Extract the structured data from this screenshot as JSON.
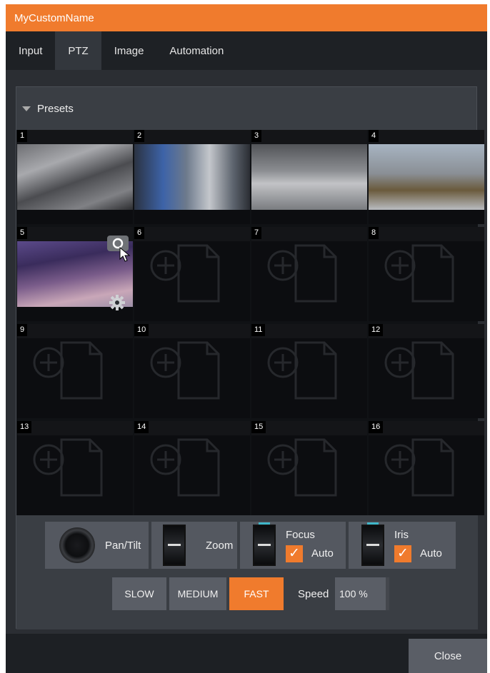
{
  "window": {
    "title": "MyCustomName"
  },
  "tabs": [
    {
      "label": "Input"
    },
    {
      "label": "PTZ"
    },
    {
      "label": "Image"
    },
    {
      "label": "Automation"
    }
  ],
  "active_tab": "PTZ",
  "presets": {
    "header": "Presets",
    "cells": [
      {
        "num": "1",
        "filled": true
      },
      {
        "num": "2",
        "filled": true
      },
      {
        "num": "3",
        "filled": true
      },
      {
        "num": "4",
        "filled": true
      },
      {
        "num": "5",
        "filled": true
      },
      {
        "num": "6",
        "filled": false
      },
      {
        "num": "7",
        "filled": false
      },
      {
        "num": "8",
        "filled": false
      },
      {
        "num": "9",
        "filled": false
      },
      {
        "num": "10",
        "filled": false
      },
      {
        "num": "11",
        "filled": false
      },
      {
        "num": "12",
        "filled": false
      },
      {
        "num": "13",
        "filled": false
      },
      {
        "num": "14",
        "filled": false
      },
      {
        "num": "15",
        "filled": false
      },
      {
        "num": "16",
        "filled": false
      }
    ]
  },
  "controls": {
    "pan_tilt": "Pan/Tilt",
    "zoom": "Zoom",
    "focus": "Focus",
    "iris": "Iris",
    "auto": "Auto",
    "focus_auto_checked": true,
    "iris_auto_checked": true,
    "speed_buttons": [
      "SLOW",
      "MEDIUM",
      "FAST"
    ],
    "speed_selected": "FAST",
    "speed_label": "Speed",
    "speed_value": "100 %"
  },
  "footer": {
    "close": "Close"
  },
  "colors": {
    "accent": "#f07b2d",
    "panel": "#3a3e44",
    "background": "#2b2e33"
  }
}
